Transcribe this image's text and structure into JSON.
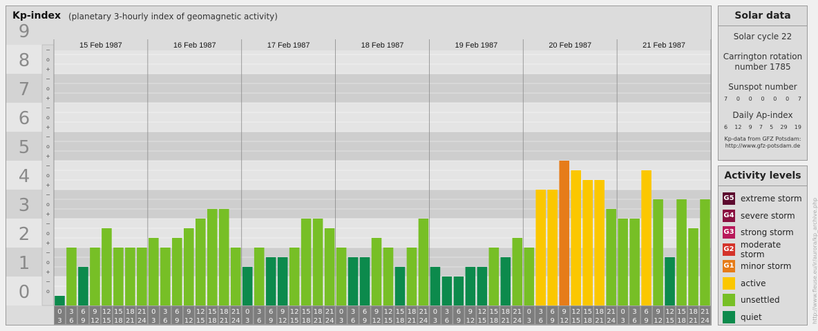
{
  "header": {
    "title": "Kp-index",
    "subtitle": "(planetary 3-hourly index of geomagnetic activity)"
  },
  "chart_data": {
    "type": "bar",
    "title": "Kp-index",
    "subtitle": "(planetary 3-hourly index of geomagnetic activity)",
    "ylim": [
      0,
      9
    ],
    "y_ticks": [
      "0",
      "1",
      "2",
      "3",
      "4",
      "5",
      "6",
      "7",
      "8",
      "9"
    ],
    "sub_ticks": [
      "+",
      "o",
      "−"
    ],
    "days": [
      "15 Feb 1987",
      "16 Feb 1987",
      "17 Feb 1987",
      "18 Feb 1987",
      "19 Feb 1987",
      "20 Feb 1987",
      "21 Feb 1987"
    ],
    "hour_starts": [
      "0",
      "3",
      "6",
      "9",
      "12",
      "15",
      "18",
      "21"
    ],
    "hour_ends": [
      "3",
      "6",
      "9",
      "12",
      "15",
      "18",
      "21",
      "24"
    ],
    "values": [
      [
        0.333,
        2,
        1.333,
        2,
        2.667,
        2,
        2,
        2
      ],
      [
        2.333,
        2,
        2.333,
        2.667,
        3,
        3.333,
        3.333,
        2
      ],
      [
        1.333,
        2,
        1.667,
        1.667,
        2,
        3,
        3,
        2.667
      ],
      [
        2,
        1.667,
        1.667,
        2.333,
        2,
        1.333,
        2,
        3
      ],
      [
        1.333,
        1,
        1,
        1.333,
        1.333,
        2,
        1.667,
        2.333
      ],
      [
        2,
        4,
        4,
        5,
        4.667,
        4.333,
        4.333,
        3.333
      ],
      [
        3,
        3,
        4.667,
        3.667,
        1.667,
        3.667,
        2.667,
        3.667
      ]
    ],
    "colors": {
      "quiet": "#0c8a4c",
      "unsettled": "#77bf26",
      "active": "#fbc700",
      "minor": "#e67c19"
    }
  },
  "solar": {
    "title": "Solar data",
    "cycle": "Solar cycle 22",
    "carrington_1": "Carrington rotation",
    "carrington_2": "number 1785",
    "sunspot_label": "Sunspot number",
    "sunspots": [
      "7",
      "0",
      "0",
      "0",
      "0",
      "0",
      "7"
    ],
    "ap_label": "Daily Ap-index",
    "ap": [
      "6",
      "12",
      "9",
      "7",
      "5",
      "29",
      "19"
    ],
    "src_1": "Kp-data from GFZ Potsdam:",
    "src_2": "http://www.gfz-potsdam.de"
  },
  "activity": {
    "title": "Activity levels",
    "levels": [
      {
        "badge": "G5",
        "label": "extreme storm",
        "color": "#5c0a2e"
      },
      {
        "badge": "G4",
        "label": "severe storm",
        "color": "#8a1040"
      },
      {
        "badge": "G3",
        "label": "strong storm",
        "color": "#b8195a"
      },
      {
        "badge": "G2",
        "label": "moderate storm",
        "color": "#d4332a"
      },
      {
        "badge": "G1",
        "label": "minor storm",
        "color": "#e67c19"
      },
      {
        "badge": "",
        "label": "active",
        "color": "#fbc700"
      },
      {
        "badge": "",
        "label": "unsettled",
        "color": "#77bf26"
      },
      {
        "badge": "",
        "label": "quiet",
        "color": "#0c8a4c"
      }
    ]
  },
  "watermark": "http://www.fleuse.eu/ir/aurora/kp_archive.php"
}
